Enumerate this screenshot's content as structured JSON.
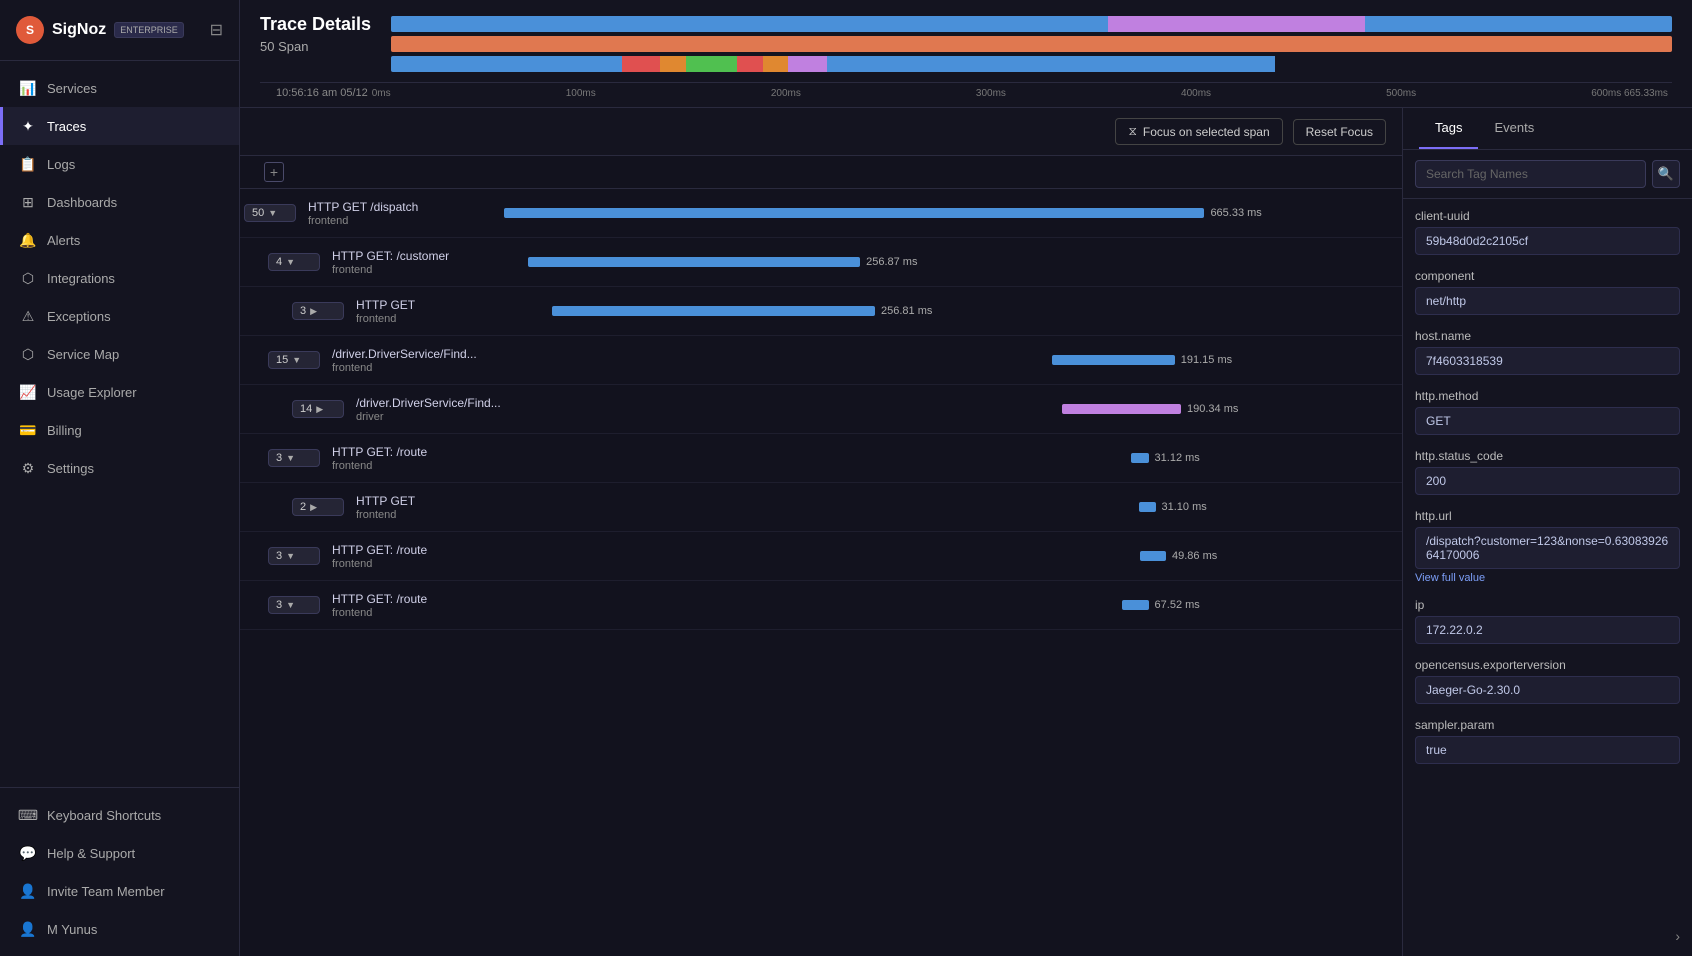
{
  "app": {
    "name": "SigNoz",
    "plan": "ENTERPRISE",
    "user": "M Yunus"
  },
  "sidebar": {
    "nav_items": [
      {
        "id": "services",
        "label": "Services",
        "icon": "📊"
      },
      {
        "id": "traces",
        "label": "Traces",
        "icon": "✦",
        "active": true
      },
      {
        "id": "logs",
        "label": "Logs",
        "icon": "📋"
      },
      {
        "id": "dashboards",
        "label": "Dashboards",
        "icon": "⊞"
      },
      {
        "id": "alerts",
        "label": "Alerts",
        "icon": "🔔"
      },
      {
        "id": "integrations",
        "label": "Integrations",
        "icon": "⬡"
      },
      {
        "id": "exceptions",
        "label": "Exceptions",
        "icon": "⚠"
      },
      {
        "id": "service-map",
        "label": "Service Map",
        "icon": "⬡"
      },
      {
        "id": "usage-explorer",
        "label": "Usage Explorer",
        "icon": "📈"
      },
      {
        "id": "billing",
        "label": "Billing",
        "icon": "💳"
      },
      {
        "id": "settings",
        "label": "Settings",
        "icon": "⚙"
      }
    ],
    "bottom_items": [
      {
        "id": "keyboard-shortcuts",
        "label": "Keyboard Shortcuts",
        "icon": "⌨"
      },
      {
        "id": "help-support",
        "label": "Help & Support",
        "icon": "💬"
      },
      {
        "id": "invite-team",
        "label": "Invite Team Member",
        "icon": "👤"
      },
      {
        "id": "user",
        "label": "M Yunus",
        "icon": "👤"
      }
    ]
  },
  "trace": {
    "title": "Trace Details",
    "span_count": "50 Span",
    "timestamp": "10:56:16 am 05/12",
    "ruler": {
      "labels": [
        "0ms",
        "100ms",
        "200ms",
        "300ms",
        "400ms",
        "500ms",
        "600ms 665.33ms"
      ]
    },
    "bars": [
      {
        "segments": [
          {
            "color": "#4a90d9",
            "width": "56%"
          },
          {
            "color": "#c080e0",
            "width": "20%"
          },
          {
            "color": "#4a90d9",
            "width": "24%"
          }
        ]
      },
      {
        "segments": [
          {
            "color": "#e07850",
            "width": "100%"
          }
        ]
      },
      {
        "segments": [
          {
            "color": "#4a90d9",
            "width": "18%"
          },
          {
            "color": "#e05050",
            "width": "3%"
          },
          {
            "color": "#e08830",
            "width": "2%"
          },
          {
            "color": "#50c050",
            "width": "4%"
          },
          {
            "color": "#e05050",
            "width": "2%"
          },
          {
            "color": "#e08830",
            "width": "2%"
          },
          {
            "color": "#c080e0",
            "width": "3%"
          },
          {
            "color": "#4a90d9",
            "width": "35%"
          }
        ]
      }
    ]
  },
  "controls": {
    "focus_label": "Focus on selected span",
    "reset_label": "Reset Focus"
  },
  "spans": [
    {
      "id": "s1",
      "count": 50,
      "expanded": true,
      "name": "HTTP GET /dispatch",
      "service": "frontend",
      "color": "#4a90d9",
      "bar_left": "0%",
      "bar_width": "78%",
      "duration": "665.33 ms",
      "duration_left": "79%",
      "indent": 0
    },
    {
      "id": "s2",
      "count": 4,
      "expanded": true,
      "name": "HTTP GET: /customer",
      "service": "frontend",
      "color": "#4a90d9",
      "bar_left": "0%",
      "bar_width": "38%",
      "duration": "256.87 ms",
      "duration_left": "39%",
      "indent": 1
    },
    {
      "id": "s3",
      "count": 3,
      "expanded": false,
      "name": "HTTP GET",
      "service": "frontend",
      "color": "#4a90d9",
      "bar_left": "0%",
      "bar_width": "38%",
      "duration": "256.81 ms",
      "duration_left": "39%",
      "indent": 2
    },
    {
      "id": "s4",
      "count": 15,
      "expanded": true,
      "name": "/driver.DriverService/Find...",
      "service": "frontend",
      "color": "#4a90d9",
      "bar_left": "60%",
      "bar_width": "14%",
      "duration": "191.15 ms",
      "duration_left": "75%",
      "indent": 1
    },
    {
      "id": "s5",
      "count": 14,
      "expanded": false,
      "name": "/driver.DriverService/Find...",
      "service": "driver",
      "color": "#c080e0",
      "bar_left": "60%",
      "bar_width": "14%",
      "duration": "190.34 ms",
      "duration_left": "75%",
      "indent": 2
    },
    {
      "id": "s6",
      "count": 3,
      "expanded": true,
      "name": "HTTP GET: /route",
      "service": "frontend",
      "color": "#4a90d9",
      "bar_left": "69%",
      "bar_width": "2%",
      "duration": "31.12 ms",
      "duration_left": "72%",
      "indent": 1
    },
    {
      "id": "s7",
      "count": 2,
      "expanded": false,
      "name": "HTTP GET",
      "service": "frontend",
      "color": "#4a90d9",
      "bar_left": "69%",
      "bar_width": "2%",
      "duration": "31.10 ms",
      "duration_left": "72%",
      "indent": 2
    },
    {
      "id": "s8",
      "count": 3,
      "expanded": true,
      "name": "HTTP GET: /route",
      "service": "frontend",
      "color": "#4a90d9",
      "bar_left": "70%",
      "bar_width": "3%",
      "duration": "49.86 ms",
      "duration_left": "74%",
      "indent": 1
    },
    {
      "id": "s9",
      "count": 3,
      "expanded": true,
      "name": "HTTP GET: /route",
      "service": "frontend",
      "color": "#4a90d9",
      "bar_left": "68%",
      "bar_width": "3%",
      "duration": "67.52 ms",
      "duration_left": "72%",
      "indent": 1
    }
  ],
  "right_panel": {
    "tabs": [
      "Tags",
      "Events"
    ],
    "active_tab": "Tags",
    "search_placeholder": "Search Tag Names",
    "tags": [
      {
        "key": "client-uuid",
        "value": "59b48d0d2c2105cf",
        "link": null
      },
      {
        "key": "component",
        "value": "net/http",
        "link": null
      },
      {
        "key": "host.name",
        "value": "7f4603318539",
        "link": null
      },
      {
        "key": "http.method",
        "value": "GET",
        "link": null
      },
      {
        "key": "http.status_code",
        "value": "200",
        "link": null
      },
      {
        "key": "http.url",
        "value": "/dispatch?customer=123&nonse=0.6308392664170006",
        "link": "View full value"
      },
      {
        "key": "ip",
        "value": "172.22.0.2",
        "link": null
      },
      {
        "key": "opencensus.exporterversion",
        "value": "Jaeger-Go-2.30.0",
        "link": null
      },
      {
        "key": "sampler.param",
        "value": "true",
        "link": null
      }
    ]
  }
}
